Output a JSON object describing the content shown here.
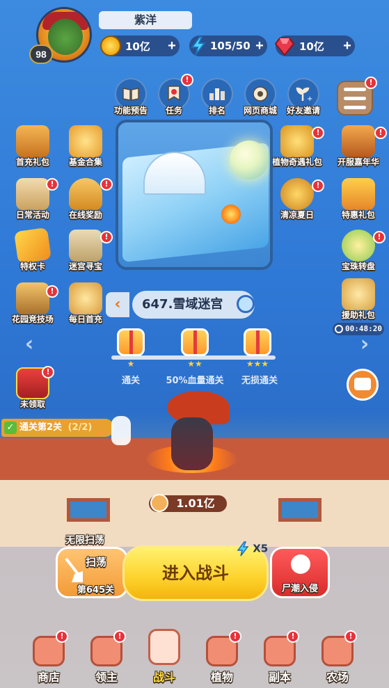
{
  "player": {
    "name": "紫洋",
    "level": "98"
  },
  "resources": {
    "gold": "10亿",
    "energy": "105/50",
    "gems": "10亿",
    "plus": "+"
  },
  "top_menu": [
    {
      "label": "功能预告",
      "icon": "book-icon"
    },
    {
      "label": "任务",
      "icon": "banner-icon"
    },
    {
      "label": "排名",
      "icon": "ranking-icon"
    },
    {
      "label": "网页商城",
      "icon": "aperture-icon"
    },
    {
      "label": "好友邀请",
      "icon": "sprout-plus-icon"
    }
  ],
  "left_menu": [
    {
      "label": "首充礼包",
      "icon": "treasure-chest-icon"
    },
    {
      "label": "基金合集",
      "icon": "coin-bag-icon"
    },
    {
      "label": "日常活动",
      "icon": "scroll-icon"
    },
    {
      "label": "在线奖励",
      "icon": "horn-icon"
    },
    {
      "label": "特权卡",
      "icon": "vip-card-icon"
    },
    {
      "label": "迷宫寻宝",
      "icon": "treasure-map-icon"
    },
    {
      "label": "花园竞技场",
      "icon": "crossed-swords-icon"
    },
    {
      "label": "每日首充",
      "icon": "gift-bag-icon"
    },
    {
      "label": "未领取",
      "icon": "red-chest-icon"
    }
  ],
  "right_menu": [
    {
      "label": "植物奇遇礼包",
      "icon": "plant-gift-icon"
    },
    {
      "label": "开服嘉年华",
      "icon": "carnival-chest-icon"
    },
    {
      "label": "清凉夏日",
      "icon": "summer-icon"
    },
    {
      "label": "特惠礼包",
      "icon": "discount-gift-icon"
    },
    {
      "label": "宝珠转盘",
      "icon": "orb-wheel-icon"
    },
    {
      "label": "援助礼包",
      "icon": "aid-gift-icon",
      "timer": "00:48:20"
    }
  ],
  "stage": {
    "name": "647.雪域迷宫",
    "prev_arrow": "‹",
    "goals": [
      {
        "label": "通关",
        "stars": "★"
      },
      {
        "label": "50%血量通关",
        "stars": "★★"
      },
      {
        "label": "无损通关",
        "stars": "★★★"
      }
    ]
  },
  "quest": {
    "text": "通关第2关",
    "progress": "(2/2)"
  },
  "power": "1.01亿",
  "battle": {
    "sweep_unlimited": "无限扫荡",
    "sweep_label": "扫荡",
    "sweep_stage": "第645关",
    "enter_label": "进入战斗",
    "energy_cost": "X5",
    "zombie_label": "尸潮入侵"
  },
  "nav": [
    {
      "label": "商店",
      "icon": "shop-icon"
    },
    {
      "label": "领主",
      "icon": "lord-icon"
    },
    {
      "label": "战斗",
      "icon": "battle-icon",
      "active": true
    },
    {
      "label": "植物",
      "icon": "plant-icon"
    },
    {
      "label": "副本",
      "icon": "dungeon-icon"
    },
    {
      "label": "农场",
      "icon": "farm-icon"
    }
  ],
  "badge": "!"
}
